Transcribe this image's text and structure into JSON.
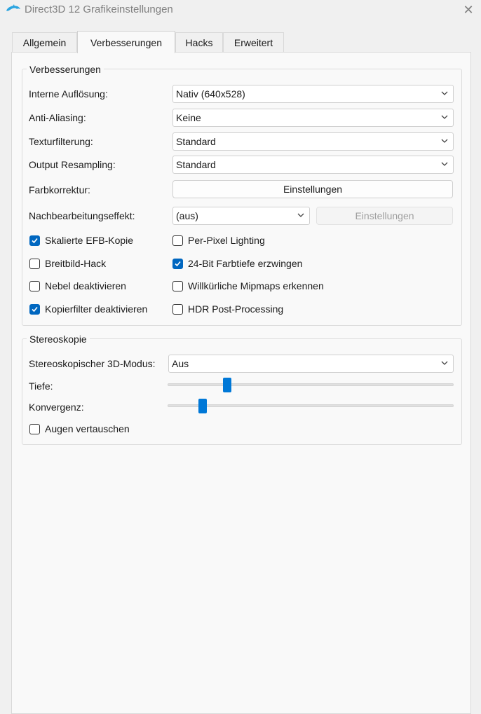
{
  "window": {
    "title": "Direct3D 12 Grafikeinstellungen",
    "logo_icon": "dolphin-icon",
    "close_icon": "close-icon"
  },
  "tabs": [
    {
      "label": "Allgemein",
      "active": false
    },
    {
      "label": "Verbesserungen",
      "active": true
    },
    {
      "label": "Hacks",
      "active": false
    },
    {
      "label": "Erweitert",
      "active": false
    }
  ],
  "enhancements": {
    "title": "Verbesserungen",
    "internal_resolution": {
      "label": "Interne Auflösung:",
      "value": "Nativ (640x528)"
    },
    "anti_aliasing": {
      "label": "Anti-Aliasing:",
      "value": "Keine"
    },
    "texture_filtering": {
      "label": "Texturfilterung:",
      "value": "Standard"
    },
    "output_resampling": {
      "label": "Output Resampling:",
      "value": "Standard"
    },
    "color_correction": {
      "label": "Farbkorrektur:",
      "button": "Einstellungen"
    },
    "post_processing": {
      "label": "Nachbearbeitungseffekt:",
      "value": "(aus)",
      "button": "Einstellungen",
      "button_disabled": true
    },
    "checkboxes": {
      "scaled_efb": {
        "label": "Skalierte EFB-Kopie",
        "checked": true
      },
      "per_pixel": {
        "label": "Per-Pixel Lighting",
        "checked": false
      },
      "widescreen": {
        "label": "Breitbild-Hack",
        "checked": false
      },
      "force_24bit": {
        "label": "24-Bit Farbtiefe erzwingen",
        "checked": true
      },
      "disable_fog": {
        "label": "Nebel deaktivieren",
        "checked": false
      },
      "arbitrary_mipmaps": {
        "label": "Willkürliche Mipmaps erkennen",
        "checked": false
      },
      "disable_copy_filter": {
        "label": "Kopierfilter deaktivieren",
        "checked": true
      },
      "hdr_post": {
        "label": "HDR Post-Processing",
        "checked": false
      }
    }
  },
  "stereoscopy": {
    "title": "Stereoskopie",
    "mode": {
      "label": "Stereoskopischer 3D-Modus:",
      "value": "Aus"
    },
    "depth": {
      "label": "Tiefe:",
      "level": 0.2
    },
    "convergence": {
      "label": "Konvergenz:",
      "level": 0.11
    },
    "swap_eyes": {
      "label": "Augen vertauschen",
      "checked": false
    }
  },
  "colors": {
    "accent": "#0067c0",
    "slider_thumb": "#0078d7"
  }
}
